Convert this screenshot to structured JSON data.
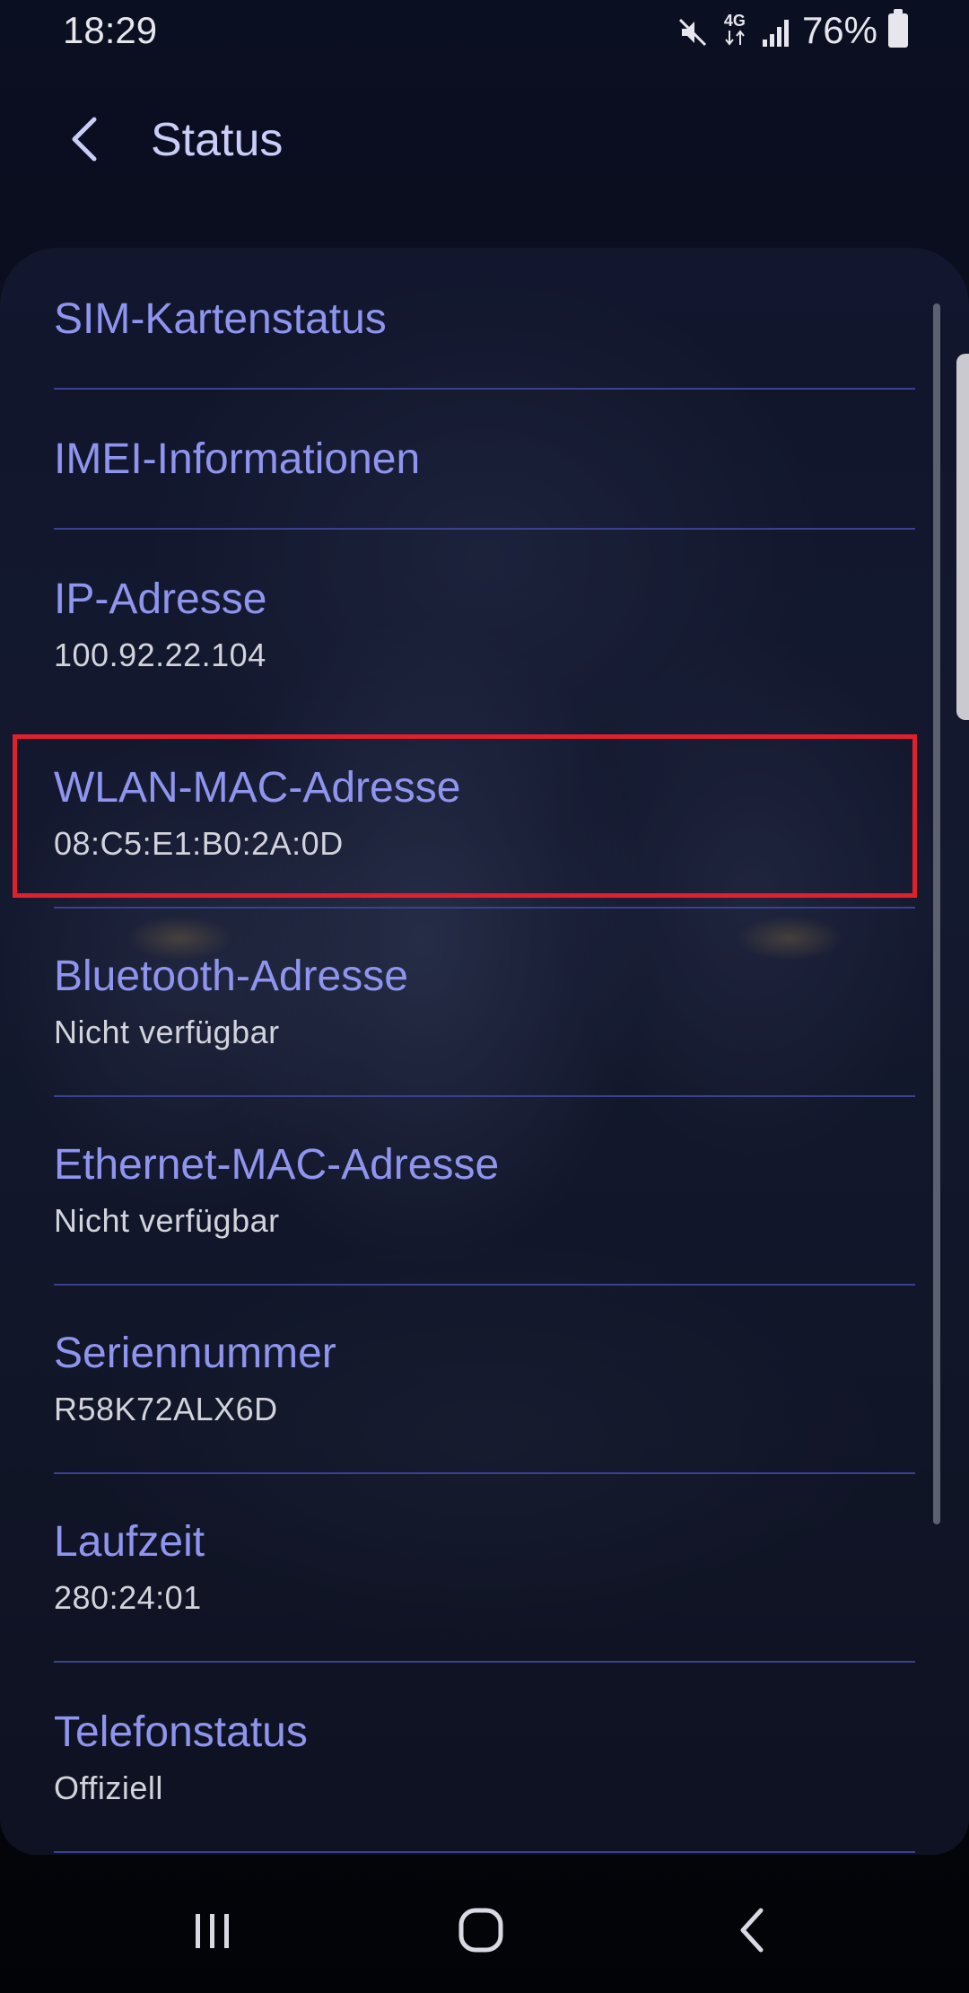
{
  "status_bar": {
    "time": "18:29",
    "network": "4G",
    "battery": "76%",
    "icons": [
      "mute-icon",
      "lte-icon",
      "signal-icon",
      "battery-icon"
    ]
  },
  "header": {
    "title": "Status",
    "back_icon": "chevron-left-icon"
  },
  "list": {
    "items": [
      {
        "title": "SIM-Kartenstatus",
        "subtitle": ""
      },
      {
        "title": "IMEI-Informationen",
        "subtitle": ""
      },
      {
        "title": "IP-Adresse",
        "subtitle": "100.92.22.104"
      },
      {
        "title": "WLAN-MAC-Adresse",
        "subtitle": "08:C5:E1:B0:2A:0D"
      },
      {
        "title": "Bluetooth-Adresse",
        "subtitle": "Nicht verfügbar"
      },
      {
        "title": "Ethernet-MAC-Adresse",
        "subtitle": "Nicht verfügbar"
      },
      {
        "title": "Seriennummer",
        "subtitle": "R58K72ALX6D"
      },
      {
        "title": "Laufzeit",
        "subtitle": "280:24:01"
      },
      {
        "title": "Telefonstatus",
        "subtitle": "Offiziell"
      }
    ]
  },
  "nav_bar": {
    "icons": [
      "recents-icon",
      "home-icon",
      "back-icon"
    ]
  },
  "colors": {
    "title_text": "#8f95ef",
    "subtitle_text": "#d2d3db",
    "divider": "#3a418f",
    "highlight": "#e0202c"
  }
}
